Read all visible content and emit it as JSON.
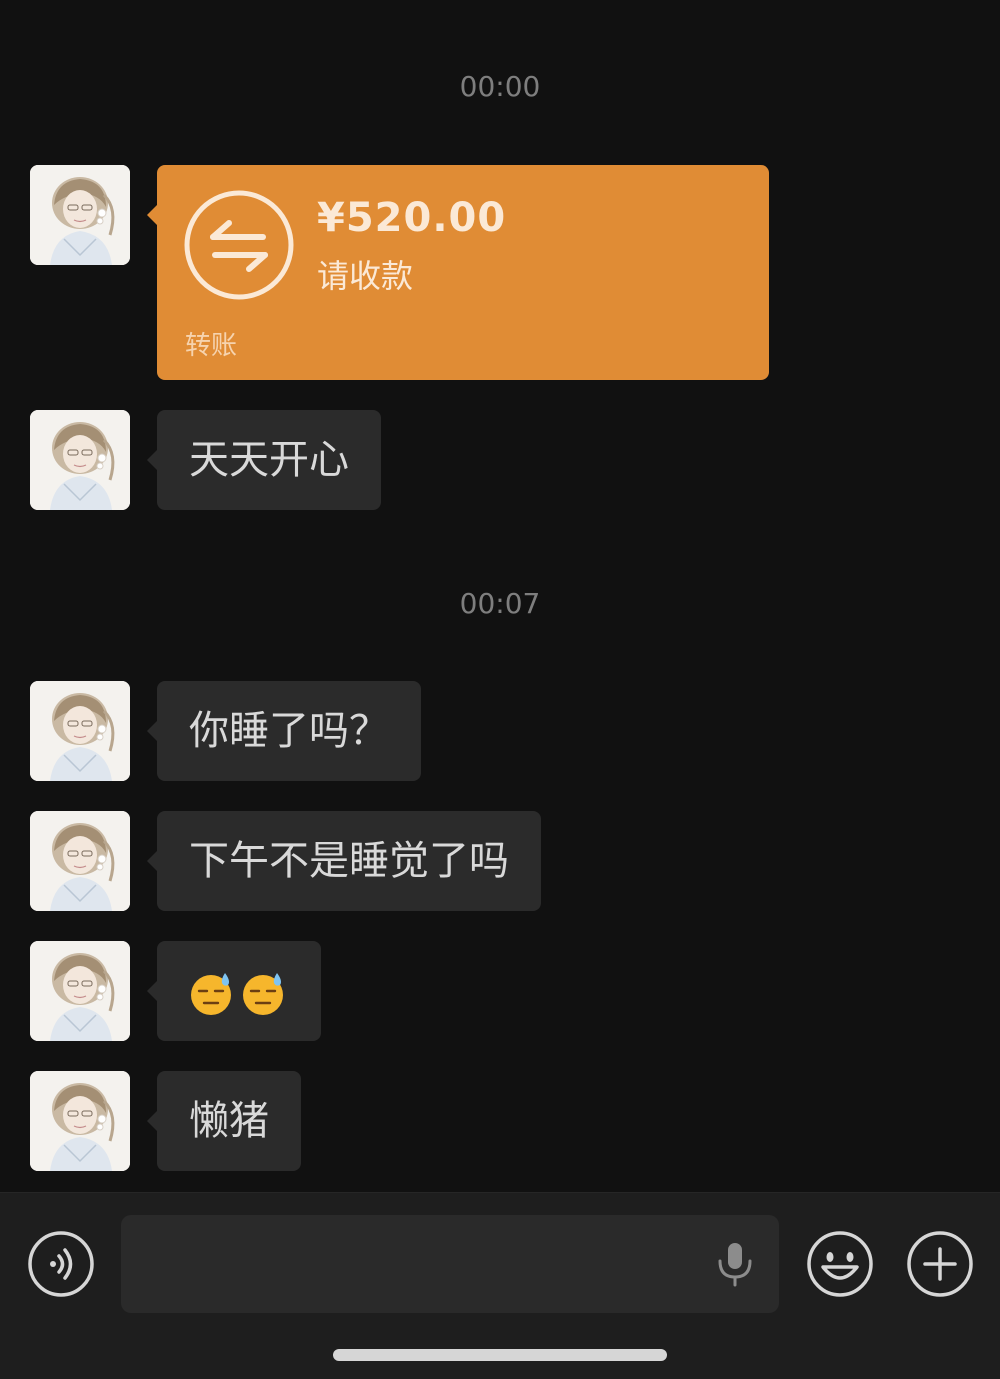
{
  "colors": {
    "background": "#111111",
    "bubble": "#2b2b2b",
    "transfer": "#e08c35",
    "timestamp": "#7e7e7e"
  },
  "chat": {
    "timestamps": [
      "00:00",
      "00:07"
    ],
    "transfer": {
      "amount": "¥520.00",
      "note": "请收款",
      "label": "转账",
      "icon": "transfer-arrows-icon"
    },
    "messages": [
      {
        "text": "天天开心"
      },
      {
        "text": "你睡了吗？"
      },
      {
        "text": "下午不是睡觉了吗"
      },
      {
        "emoji": [
          "sweat-face-icon",
          "sweat-face-icon"
        ]
      },
      {
        "text": "懒猪"
      }
    ]
  },
  "input_bar": {
    "voice_icon": "voice-icon",
    "input_value": "",
    "mic_icon": "microphone-icon",
    "emoji_icon": "smiley-icon",
    "plus_icon": "plus-icon"
  }
}
